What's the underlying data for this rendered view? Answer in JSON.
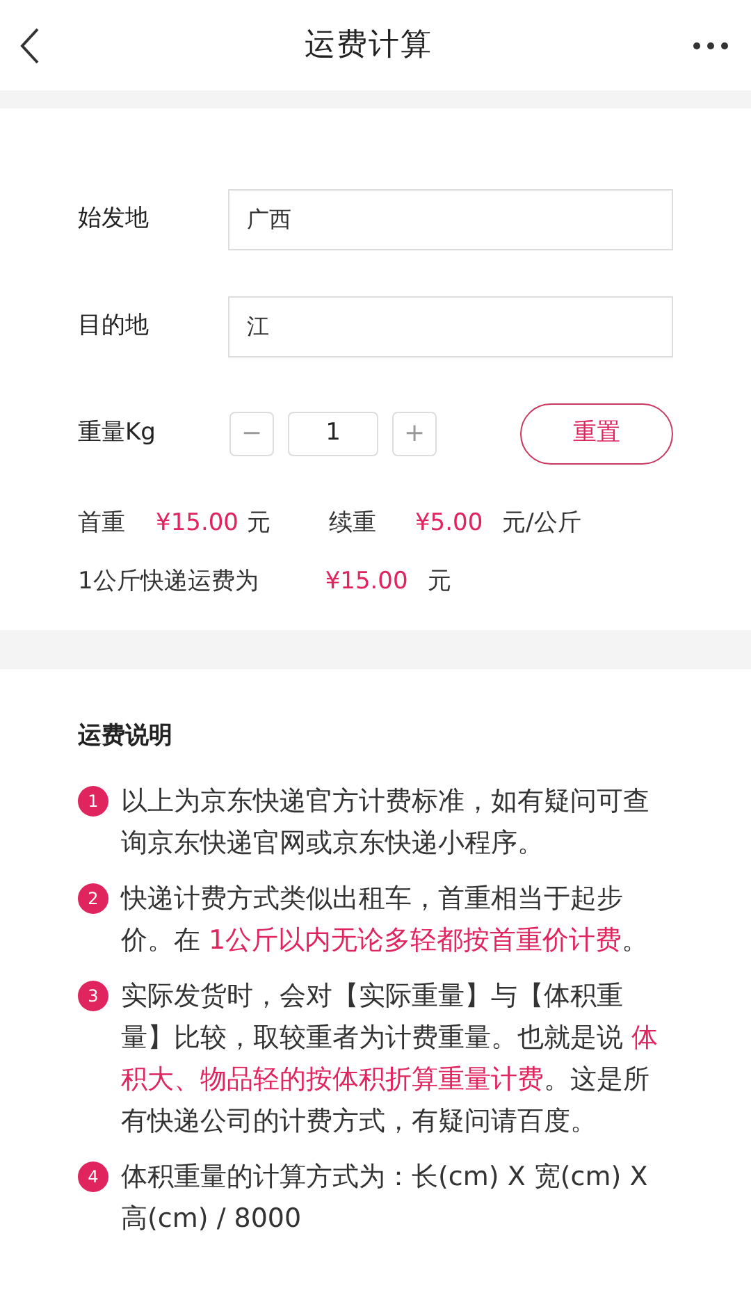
{
  "header": {
    "title": "运费计算"
  },
  "form": {
    "fields": [
      {
        "label": "始发地",
        "value": "广西"
      },
      {
        "label": "目的地",
        "value": "江"
      }
    ],
    "weight": {
      "label": "重量Kg",
      "minus": "−",
      "value": "1",
      "plus": "+"
    },
    "reset_button": "重置"
  },
  "summary": {
    "first_weight_label": "首重",
    "first_weight_price": "¥15.00",
    "first_weight_unit": "元",
    "extra_weight_label": "续重",
    "extra_weight_price": "¥5.00",
    "extra_weight_unit": "元/公斤",
    "total_label": "1公斤快递运费为",
    "total_price": "¥15.00",
    "total_unit": "元"
  },
  "notes": {
    "title": "运费说明",
    "items": [
      {
        "number": "1",
        "segments": [
          {
            "text": "以上为京东快递官方计费标准，如有疑问可查询京东快递官网或京东快递小程序。",
            "highlight": false
          }
        ]
      },
      {
        "number": "2",
        "segments": [
          {
            "text": "快递计费方式类似出租车，首重相当于起步价。在 ",
            "highlight": false
          },
          {
            "text": "1公斤以内无论多轻都按首重价计费",
            "highlight": true
          },
          {
            "text": "。",
            "highlight": false
          }
        ]
      },
      {
        "number": "3",
        "segments": [
          {
            "text": "实际发货时，会对【实际重量】与【体积重量】比较，取较重者为计费重量。也就是说 ",
            "highlight": false
          },
          {
            "text": "体积大、物品轻的按体积折算重量计费",
            "highlight": true
          },
          {
            "text": "。这是所有快递公司的计费方式，有疑问请百度。",
            "highlight": false
          }
        ]
      },
      {
        "number": "4",
        "segments": [
          {
            "text": "体积重量的计算方式为：长(cm) X 宽(cm) X 高(cm) / 8000",
            "highlight": false
          }
        ]
      }
    ]
  }
}
